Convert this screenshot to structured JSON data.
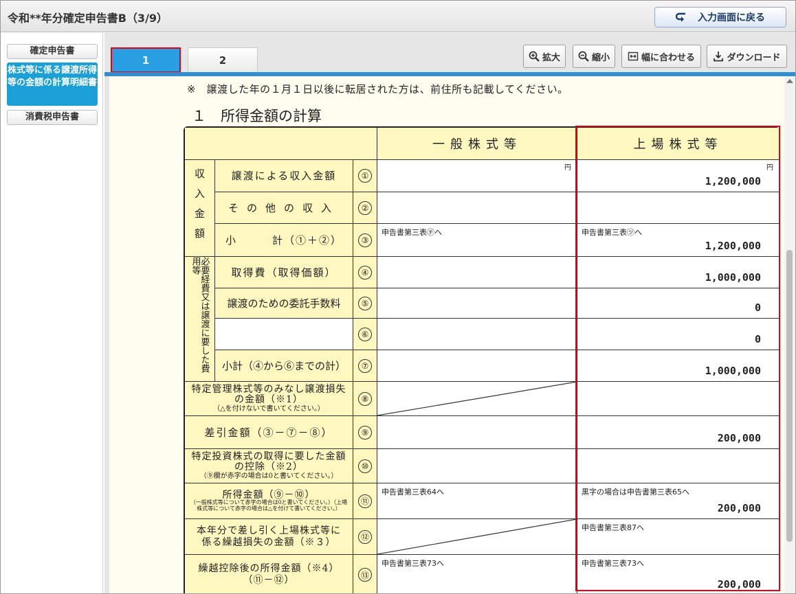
{
  "window": {
    "title": "令和**年分確定申告書B（3/9）",
    "back_button": "入力画面に戻る"
  },
  "sidebar": {
    "items": [
      {
        "label": "確定申告書"
      },
      {
        "label": "株式等に係る譲渡所得等の金額の計算明細書"
      },
      {
        "label": "消費税申告書"
      }
    ]
  },
  "tabs": [
    {
      "label": "1"
    },
    {
      "label": "2"
    }
  ],
  "toolbar": {
    "zoom_in": "拡大",
    "zoom_out": "縮小",
    "fit_width": "幅に合わせる",
    "download": "ダウンロード"
  },
  "document": {
    "note": "※　譲渡した年の１月１日以後に転居された方は、前住所も記載してください。",
    "section_title": "１　所得金額の計算",
    "col_general": "一般株式等",
    "col_listed": "上場株式等",
    "yen": "円",
    "group_income": "収入金額",
    "group_expense": "必要経費又は譲渡に要した費用等",
    "rows": [
      {
        "no": "①",
        "label": "譲渡による収入金額",
        "general_ref": "",
        "listed_ref": "",
        "listed": "1,200,000"
      },
      {
        "no": "②",
        "label": "その他の収入",
        "general_ref": "",
        "listed_ref": "",
        "listed": ""
      },
      {
        "no": "③",
        "label": "小　　　計（①＋②）",
        "general_ref": "申告書第三表㋠へ",
        "listed_ref": "申告書第三表㋡へ",
        "listed": "1,200,000"
      },
      {
        "no": "④",
        "label": "取得費（取得価額）",
        "general_ref": "",
        "listed_ref": "",
        "listed": "1,000,000"
      },
      {
        "no": "⑤",
        "label": "譲渡のための委託手数料",
        "general_ref": "",
        "listed_ref": "",
        "listed": "0"
      },
      {
        "no": "⑥",
        "label": "",
        "general_ref": "",
        "listed_ref": "",
        "listed": "0"
      },
      {
        "no": "⑦",
        "label": "小計（④から⑥までの計）",
        "general_ref": "",
        "listed_ref": "",
        "listed": "1,000,000"
      },
      {
        "no": "⑧",
        "label": "特定管理株式等のみなし譲渡損失の金額（※1）",
        "sub": "（△を付けないで書いてください。）",
        "general_ref": "",
        "listed_ref": "",
        "listed": ""
      },
      {
        "no": "⑨",
        "label": "差引金額（③－⑦－⑧）",
        "general_ref": "",
        "listed_ref": "",
        "listed": "200,000"
      },
      {
        "no": "⑩",
        "label": "特定投資株式の取得に要した金額の控除（※2）",
        "sub": "（⑨欄が赤字の場合は0と書いてください。）",
        "general_ref": "",
        "listed_ref": "",
        "listed": ""
      },
      {
        "no": "⑪",
        "label": "所得金額（⑨－⑩）",
        "sub": "（一般株式等について赤字の場合は0と書いてください。）（上場株式等について赤字の場合は△を付けて書いてください。）",
        "general_ref": "申告書第三表64へ",
        "listed_ref": "黒字の場合は申告書第三表65へ",
        "listed": "200,000"
      },
      {
        "no": "⑫",
        "label": "本年分で差し引く上場株式等に係る繰越損失の金額（※３）",
        "general_ref": "",
        "listed_ref": "申告書第三表87へ",
        "listed": ""
      },
      {
        "no": "⑬",
        "label": "繰越控除後の所得金額（※4）（⑪－⑫）",
        "general_ref": "申告書第三表73へ",
        "listed_ref": "申告書第三表73へ",
        "listed": "200,000"
      }
    ]
  }
}
